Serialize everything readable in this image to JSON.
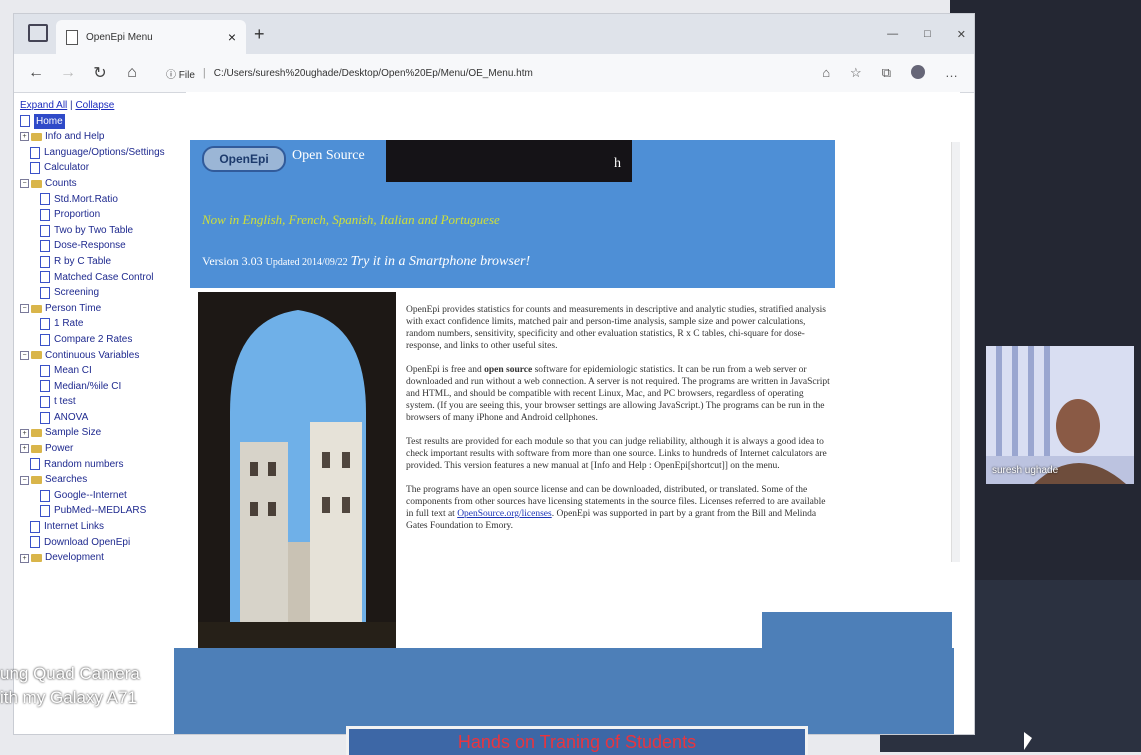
{
  "browser": {
    "tab_title": "OpenEpi Menu",
    "tab_close": "×",
    "new_tab": "+",
    "window_controls": [
      "—",
      "□",
      "✕"
    ],
    "address": {
      "info_label": "File",
      "url": "C:/Users/suresh%20ughade/Desktop/Open%20Ep/Menu/OE_Menu.htm"
    },
    "toolbar_icons": [
      "read-aloud-icon",
      "favorite-icon",
      "collections-icon",
      "profile-icon",
      "more-icon"
    ]
  },
  "sidebar": {
    "expand_all": "Expand All",
    "separator": "|",
    "collapse": "Collapse",
    "items": [
      {
        "label": "Home",
        "kind": "page",
        "selected": true,
        "indent": 0
      },
      {
        "label": "Info and Help",
        "kind": "folder",
        "pm": "+",
        "indent": 0
      },
      {
        "label": "Language/Options/Settings",
        "kind": "special",
        "indent": 1
      },
      {
        "label": "Calculator",
        "kind": "page",
        "indent": 1
      },
      {
        "label": "Counts",
        "kind": "folder",
        "pm": "−",
        "indent": 0
      },
      {
        "label": "Std.Mort.Ratio",
        "kind": "page",
        "indent": 2
      },
      {
        "label": "Proportion",
        "kind": "page",
        "indent": 2
      },
      {
        "label": "Two by Two Table",
        "kind": "page",
        "indent": 2
      },
      {
        "label": "Dose-Response",
        "kind": "page",
        "indent": 2
      },
      {
        "label": "R by C Table",
        "kind": "page",
        "indent": 2
      },
      {
        "label": "Matched Case Control",
        "kind": "page",
        "indent": 2
      },
      {
        "label": "Screening",
        "kind": "page",
        "indent": 2
      },
      {
        "label": "Person Time",
        "kind": "folder",
        "pm": "−",
        "indent": 0
      },
      {
        "label": "1 Rate",
        "kind": "page",
        "indent": 2
      },
      {
        "label": "Compare 2 Rates",
        "kind": "page",
        "indent": 2
      },
      {
        "label": "Continuous Variables",
        "kind": "folder",
        "pm": "−",
        "indent": 0
      },
      {
        "label": "Mean CI",
        "kind": "page",
        "indent": 2
      },
      {
        "label": "Median/%ile CI",
        "kind": "page",
        "indent": 2
      },
      {
        "label": "t test",
        "kind": "page",
        "indent": 2
      },
      {
        "label": "ANOVA",
        "kind": "page",
        "indent": 2
      },
      {
        "label": "Sample Size",
        "kind": "folder",
        "pm": "+",
        "indent": 0
      },
      {
        "label": "Power",
        "kind": "folder",
        "pm": "+",
        "indent": 0
      },
      {
        "label": "Random numbers",
        "kind": "page",
        "indent": 1
      },
      {
        "label": "Searches",
        "kind": "folder",
        "pm": "−",
        "indent": 0
      },
      {
        "label": "Google--Internet",
        "kind": "page",
        "indent": 2
      },
      {
        "label": "PubMed--MEDLARS",
        "kind": "page",
        "indent": 2
      },
      {
        "label": "Internet Links",
        "kind": "page",
        "indent": 1
      },
      {
        "label": "Download OpenEpi",
        "kind": "page",
        "indent": 1
      },
      {
        "label": "Development",
        "kind": "folder",
        "pm": "+",
        "indent": 0
      }
    ]
  },
  "banner": {
    "logo": "OpenEpi",
    "title_left": "Open Source",
    "title_right": "h",
    "languages": "Now in English, French, Spanish, Italian and Portuguese",
    "version": "Version 3.03",
    "updated": "Updated 2014/09/22",
    "try": "Try it in a Smartphone browser!"
  },
  "body": {
    "p1": "OpenEpi provides statistics for counts and measurements in descriptive and analytic studies, stratified analysis with exact confidence limits, matched pair and person-time analysis, sample size and power calculations, random numbers, sensitivity, specificity and other evaluation statistics, R x C tables, chi-square for dose-response, and links to other useful sites.",
    "p2a": "OpenEpi is free and ",
    "p2b": "open source",
    "p2c": " software for epidemiologic statistics. It can be run from a web server or downloaded and run without a web connection. A server is not required. The programs are written in JavaScript and HTML, and should be compatible with recent Linux, Mac, and PC browsers, regardless of operating system. (If you are seeing this, your browser settings are allowing JavaScript.) The programs can be run in the browsers of many iPhone and Android cellphones.",
    "p3": "Test results are provided for each module so that you can judge reliability, although it is always a good idea to check important results with software from more than one source. Links to hundreds of Internet calculators are provided. This version features a new manual at [Info and Help : OpenEpi[shortcut]] on the menu.",
    "p4a": "The programs have an open source license and can be downloaded, distributed, or translated. Some of the components from other sources have licensing statements in the source files. Licenses referred to are available in full text at ",
    "p4link": "OpenSource.org/licenses",
    "p4b": ". OpenEpi was supported in part by a grant from the Bill and Melinda Gates Foundation to Emory."
  },
  "overlays": {
    "camera_line1": "ung Quad Camera",
    "camera_line2": "ith my Galaxy A71",
    "video_name": "suresh ughade",
    "bottom_banner": "Hands on Traning of Students"
  },
  "colors": {
    "banner_blue": "#4e8fd6",
    "language_yellow": "#cfe038",
    "link_blue": "#1e37b6",
    "selected_bg": "#2f4ac8"
  }
}
